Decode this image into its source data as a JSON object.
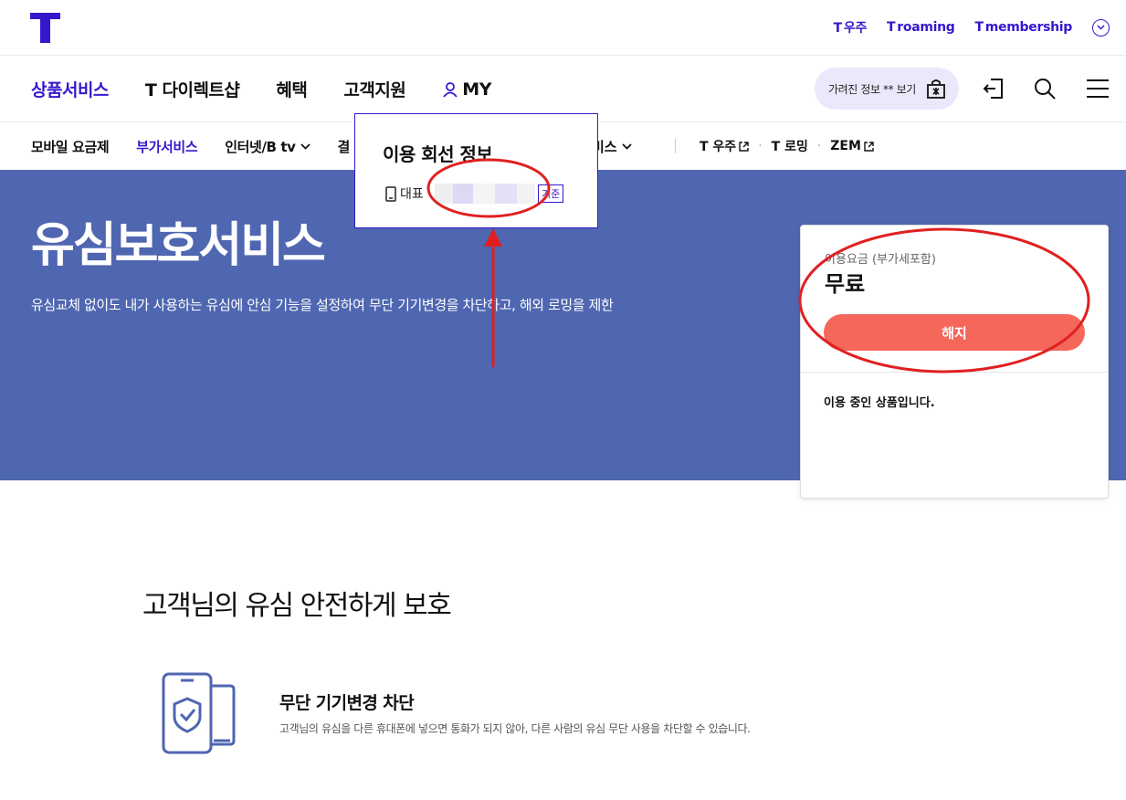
{
  "brand": {
    "accent": "#3617ce",
    "hero_bg": "#4f66b1",
    "cancel_color": "#f4675a"
  },
  "utility_links": [
    {
      "mark": "T",
      "label": "우주"
    },
    {
      "mark": "T",
      "label": "roaming"
    },
    {
      "mark": "T",
      "label": "membership"
    }
  ],
  "main_nav": {
    "items": [
      "상품서비스",
      "T 다이렉트샵",
      "혜택",
      "고객지원"
    ],
    "my_label": "MY",
    "hidden_info_label": "가려진 정보 ** 보기"
  },
  "sub_nav": {
    "items": [
      "모바일 요금제",
      "부가서비스",
      "인터넷/B tv",
      "결"
    ],
    "dropdown_item": "비스",
    "external": [
      "T 우주",
      "T 로밍",
      "ZEM"
    ]
  },
  "popup": {
    "title": "이용 회선 정보",
    "row_label": "대표",
    "badge": "기준"
  },
  "hero": {
    "title": "유심보호서비스",
    "description": "유심교체 없이도 내가 사용하는 유심에 안심 기능을 설정하여 무단 기기변경을 차단하고, 해외 로밍을 제한"
  },
  "price_card": {
    "fee_label": "이용요금 (부가세포함)",
    "fee_value": "무료",
    "cancel_button": "해지",
    "status": "이용 중인 상품입니다."
  },
  "content": {
    "section_title": "고객님의 유심 안전하게 보호",
    "feature_title": "무단 기기변경 차단",
    "feature_desc": "고객님의 유심을 다른 휴대폰에 넣으면 통화가 되지 않아, 다른 사람의 유심 무단 사용을 차단할 수 있습니다."
  },
  "icons": [
    "t-logo-icon",
    "chevron-down-circle-icon",
    "user-icon",
    "lock-bag-icon",
    "logout-icon",
    "search-icon",
    "hamburger-icon",
    "phone-icon",
    "external-link-icon",
    "phone-shield-icon"
  ]
}
